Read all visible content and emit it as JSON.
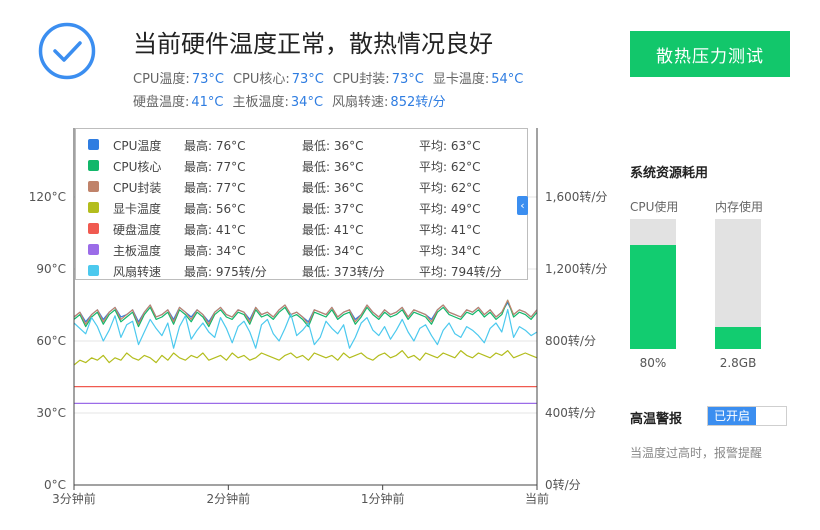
{
  "header": {
    "headline": "当前硬件温度正常，散热情况良好",
    "stats_row_1": [
      {
        "label": "CPU温度:",
        "value": "73°C"
      },
      {
        "label": "CPU核心:",
        "value": "73°C"
      },
      {
        "label": "CPU封装:",
        "value": "73°C"
      },
      {
        "label": "显卡温度:",
        "value": "54°C"
      }
    ],
    "stats_row_2": [
      {
        "label": "硬盘温度:",
        "value": "41°C"
      },
      {
        "label": "主板温度:",
        "value": "34°C"
      },
      {
        "label": "风扇转速:",
        "value": "852转/分"
      }
    ],
    "stress_button": "散热压力测试"
  },
  "legend": {
    "collapse_icon": "‹",
    "rows": [
      {
        "name": "CPU温度",
        "max": "最高: 76°C",
        "min": "最低: 36°C",
        "avg": "平均: 63°C",
        "color": "#2f7de1"
      },
      {
        "name": "CPU核心",
        "max": "最高: 77°C",
        "min": "最低: 36°C",
        "avg": "平均: 62°C",
        "color": "#12b76a"
      },
      {
        "name": "CPU封装",
        "max": "最高: 77°C",
        "min": "最低: 36°C",
        "avg": "平均: 62°C",
        "color": "#c0836a"
      },
      {
        "name": "显卡温度",
        "max": "最高: 56°C",
        "min": "最低: 37°C",
        "avg": "平均: 49°C",
        "color": "#b3bd1d"
      },
      {
        "name": "硬盘温度",
        "max": "最高: 41°C",
        "min": "最低: 41°C",
        "avg": "平均: 41°C",
        "color": "#f05a50"
      },
      {
        "name": "主板温度",
        "max": "最高: 34°C",
        "min": "最低: 34°C",
        "avg": "平均: 34°C",
        "color": "#9b6ce8"
      },
      {
        "name": "风扇转速",
        "max": "最高: 975转/分",
        "min": "最低: 373转/分",
        "avg": "平均: 794转/分",
        "color": "#4cc9ee"
      }
    ]
  },
  "chart_data": {
    "type": "line",
    "x_ticks": [
      "3分钟前",
      "2分钟前",
      "1分钟前",
      "当前"
    ],
    "y_left_ticks": [
      "0°C",
      "30°C",
      "60°C",
      "90°C",
      "120°C"
    ],
    "y_left_range": [
      0,
      120
    ],
    "y_right_ticks": [
      "0转/分",
      "400转/分",
      "800转/分",
      "1,200转/分",
      "1,600转/分"
    ],
    "y_right_range": [
      0,
      1600
    ],
    "series": [
      {
        "name": "CPU温度",
        "color": "#2f7de1",
        "axis": "left",
        "values": [
          70,
          72,
          68,
          71,
          73,
          69,
          72,
          74,
          70,
          71,
          73,
          68,
          72,
          75,
          70,
          71,
          73,
          69,
          74,
          72,
          70,
          73,
          71,
          68,
          72,
          74,
          71,
          70,
          73,
          72,
          69,
          74,
          71,
          72,
          70,
          73,
          75,
          71,
          72,
          70,
          68,
          73,
          72,
          71,
          74,
          70,
          72,
          73,
          69,
          71,
          75,
          72,
          70,
          73,
          71,
          72,
          74,
          70,
          73,
          72,
          71,
          69,
          73,
          75,
          72,
          71,
          70,
          73,
          72,
          74,
          71,
          73,
          70,
          72,
          76,
          71,
          73,
          72,
          70,
          73
        ]
      },
      {
        "name": "CPU核心",
        "color": "#12b76a",
        "axis": "left",
        "values": [
          69,
          71,
          66,
          70,
          72,
          67,
          71,
          73,
          68,
          70,
          72,
          66,
          71,
          74,
          69,
          70,
          72,
          67,
          73,
          71,
          68,
          72,
          70,
          66,
          71,
          73,
          70,
          69,
          72,
          71,
          67,
          73,
          70,
          71,
          69,
          72,
          74,
          70,
          71,
          69,
          66,
          72,
          71,
          70,
          73,
          69,
          71,
          72,
          67,
          70,
          74,
          71,
          69,
          72,
          70,
          71,
          73,
          69,
          72,
          71,
          70,
          67,
          72,
          74,
          71,
          70,
          69,
          72,
          71,
          73,
          70,
          72,
          69,
          71,
          77,
          70,
          72,
          71,
          69,
          72
        ]
      },
      {
        "name": "CPU封装",
        "color": "#c0836a",
        "axis": "left",
        "values": [
          70,
          72,
          67,
          71,
          73,
          68,
          72,
          74,
          69,
          71,
          73,
          67,
          72,
          75,
          70,
          71,
          73,
          68,
          74,
          72,
          69,
          73,
          71,
          67,
          72,
          74,
          71,
          70,
          73,
          72,
          68,
          74,
          71,
          72,
          70,
          73,
          75,
          71,
          72,
          70,
          67,
          73,
          72,
          71,
          74,
          70,
          72,
          73,
          68,
          71,
          75,
          72,
          70,
          73,
          71,
          72,
          74,
          70,
          73,
          72,
          71,
          68,
          73,
          75,
          72,
          71,
          70,
          73,
          72,
          74,
          71,
          73,
          70,
          72,
          77,
          71,
          73,
          72,
          70,
          73
        ]
      },
      {
        "name": "显卡温度",
        "color": "#b3bd1d",
        "axis": "left",
        "values": [
          50,
          52,
          51,
          53,
          52,
          54,
          51,
          53,
          52,
          55,
          53,
          52,
          54,
          53,
          51,
          54,
          52,
          55,
          53,
          52,
          54,
          53,
          55,
          52,
          53,
          54,
          52,
          55,
          53,
          54,
          52,
          53,
          55,
          54,
          53,
          52,
          54,
          55,
          53,
          54,
          52,
          55,
          54,
          53,
          54,
          52,
          55,
          53,
          54,
          55,
          53,
          52,
          54,
          55,
          53,
          54,
          56,
          53,
          54,
          52,
          55,
          54,
          53,
          55,
          54,
          53,
          56,
          54,
          53,
          55,
          54,
          53,
          55,
          54,
          56,
          53,
          54,
          55,
          54,
          53
        ]
      },
      {
        "name": "硬盘温度",
        "color": "#f05a50",
        "axis": "left",
        "values": [
          41,
          41,
          41,
          41,
          41,
          41,
          41,
          41,
          41,
          41,
          41,
          41,
          41,
          41,
          41,
          41,
          41,
          41,
          41,
          41,
          41,
          41,
          41,
          41,
          41,
          41,
          41,
          41,
          41,
          41,
          41,
          41,
          41,
          41,
          41,
          41,
          41,
          41,
          41,
          41,
          41,
          41,
          41,
          41,
          41,
          41,
          41,
          41,
          41,
          41,
          41,
          41,
          41,
          41,
          41,
          41,
          41,
          41,
          41,
          41,
          41,
          41,
          41,
          41,
          41,
          41,
          41,
          41,
          41,
          41,
          41,
          41,
          41,
          41,
          41,
          41,
          41,
          41,
          41,
          41
        ]
      },
      {
        "name": "主板温度",
        "color": "#9b6ce8",
        "axis": "left",
        "values": [
          34,
          34,
          34,
          34,
          34,
          34,
          34,
          34,
          34,
          34,
          34,
          34,
          34,
          34,
          34,
          34,
          34,
          34,
          34,
          34,
          34,
          34,
          34,
          34,
          34,
          34,
          34,
          34,
          34,
          34,
          34,
          34,
          34,
          34,
          34,
          34,
          34,
          34,
          34,
          34,
          34,
          34,
          34,
          34,
          34,
          34,
          34,
          34,
          34,
          34,
          34,
          34,
          34,
          34,
          34,
          34,
          34,
          34,
          34,
          34,
          34,
          34,
          34,
          34,
          34,
          34,
          34,
          34,
          34,
          34,
          34,
          34,
          34,
          34,
          34,
          34,
          34,
          34,
          34,
          34
        ]
      },
      {
        "name": "风扇转速",
        "color": "#4cc9ee",
        "axis": "right",
        "values": [
          900,
          870,
          840,
          930,
          880,
          800,
          860,
          940,
          820,
          890,
          910,
          780,
          850,
          920,
          870,
          830,
          900,
          760,
          880,
          940,
          810,
          860,
          900,
          850,
          820,
          930,
          870,
          790,
          880,
          910,
          850,
          760,
          890,
          920,
          840,
          800,
          870,
          950,
          830,
          860,
          900,
          780,
          820,
          910,
          870,
          840,
          890,
          760,
          820,
          900,
          930,
          860,
          830,
          880,
          810,
          860,
          920,
          850,
          800,
          870,
          890,
          830,
          780,
          860,
          900,
          840,
          820,
          880,
          860,
          830,
          790,
          870,
          900,
          850,
          975,
          820,
          880,
          860,
          830,
          850
        ]
      }
    ]
  },
  "resources": {
    "title": "系统资源耗用",
    "cpu_label": "CPU使用",
    "cpu_value": "80%",
    "cpu_fraction": 0.8,
    "mem_label": "内存使用",
    "mem_value": "2.8GB",
    "mem_fraction": 0.17
  },
  "alert": {
    "title": "高温警报",
    "toggle_label": "已开启",
    "description": "当温度过高时，报警提醒"
  },
  "colors": {
    "accent_green": "#12c76b",
    "accent_blue": "#3b8ef0"
  }
}
